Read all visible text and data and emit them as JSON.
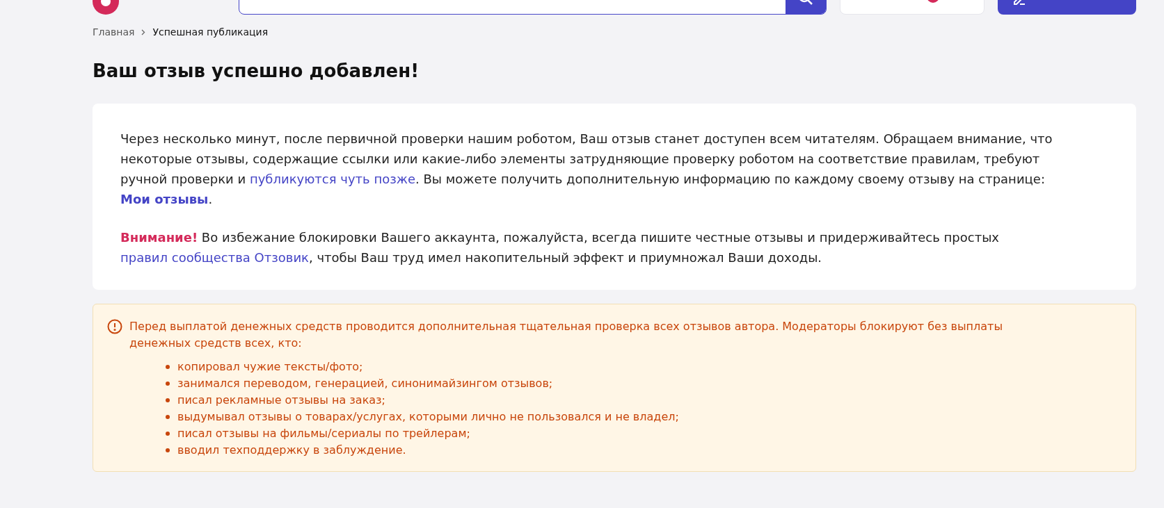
{
  "header": {
    "search": {
      "kind": "field"
    }
  },
  "breadcrumbs": [
    {
      "label": "Главная",
      "kind": "link"
    },
    {
      "label": "Успешная публикация",
      "kind": "current"
    }
  ],
  "title": "Ваш отзыв успешно добавлен!",
  "notice": {
    "paragraphs": [
      [
        {
          "kind": "text",
          "text": "Через несколько минут, после первичной проверки нашим роботом, Ваш отзыв станет доступен всем читателям. Обращаем внимание, что некоторые отзывы, содержащие ссылки или какие-либо элементы затрудняющие проверку роботом на соответствие правилам, требуют ручной проверки и "
        },
        {
          "kind": "link",
          "text": "публикуются чуть позже"
        },
        {
          "kind": "text",
          "text": ". Вы можете получить дополнительную информацию по каждому своему отзыву на странице: "
        },
        {
          "kind": "strong-link",
          "text": "Мои отзывы"
        },
        {
          "kind": "text",
          "text": "."
        }
      ],
      [
        {
          "kind": "alert",
          "text": "Внимание!"
        },
        {
          "kind": "text",
          "text": " Во избежание блокировки Вашего аккаунта, пожалуйста, всегда пишите честные отзывы и придерживайтесь простых "
        },
        {
          "kind": "link",
          "text": "правил сообщества Отзовик"
        },
        {
          "kind": "text",
          "text": ", чтобы Ваш труд имел накопительный эффект и приумножал Ваши доходы."
        }
      ]
    ]
  },
  "warning": {
    "text": "Перед выплатой денежных средств проводится дополнительная тщательная проверка всех отзывов автора. Модераторы блокируют без выплаты денежных средств всех, кто:",
    "items": [
      "копировал чужие тексты/фото;",
      "занимался переводом, генерацией, синонимайзингом отзывов;",
      "писал рекламные отзывы на заказ;",
      "выдумывал отзывы о товарах/услугах, которыми лично не пользовался и не владел;",
      "писал отзывы на фильмы/сериалы по трейлерам;",
      "вводил техподдержку в заблуждение."
    ]
  }
}
